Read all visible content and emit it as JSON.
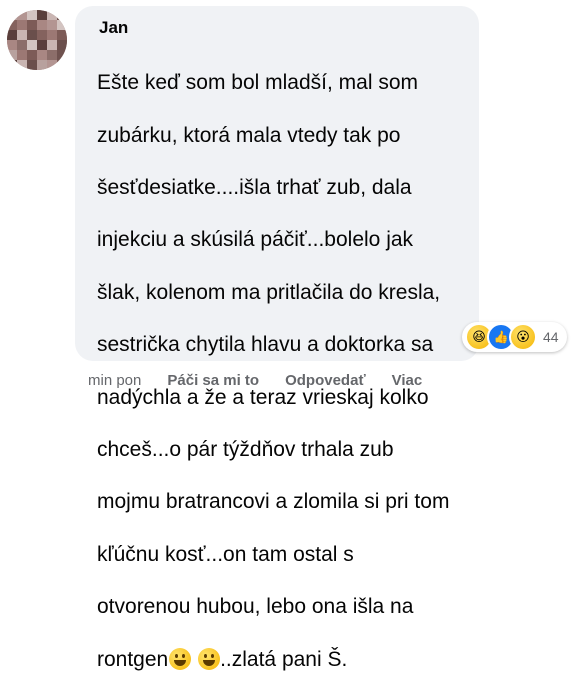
{
  "comment": {
    "author": "Jan",
    "text_lines": [
      "Ešte keď som bol mladší, mal som",
      "zubárku, ktorá mala vtedy tak po",
      "šesťdesiatke....išla trhať zub, dala",
      "injekciu a skúsilá páčiť...bolelo jak",
      "šlak, kolenom ma pritlačila do kresla,",
      "sestrička chytila hlavu a doktorka sa",
      "nadýchla a že a teraz vrieskaj kolko",
      "chceš...o pár týždňov trhala zub",
      "mojmu bratrancovi a zlomila si pri tom",
      "kľúčnu kosť...on tam ostal s",
      "otvorenou hubou, lebo ona išla na"
    ],
    "last_line_start": "rontgen",
    "last_line_end": "..zlatá pani Š.",
    "inline_emojis": [
      "grinning-face",
      "grinning-face"
    ],
    "reactions": {
      "icons": [
        "haha",
        "like",
        "wow"
      ],
      "count": "44"
    }
  },
  "actions": {
    "time": "min pon",
    "like": "Páči sa mi to",
    "reply": "Odpovedať",
    "more": "Viac"
  },
  "colors": {
    "bubble": "#f0f2f5",
    "text": "#050505",
    "secondary": "#65676b",
    "like_blue": "#1877f2"
  }
}
